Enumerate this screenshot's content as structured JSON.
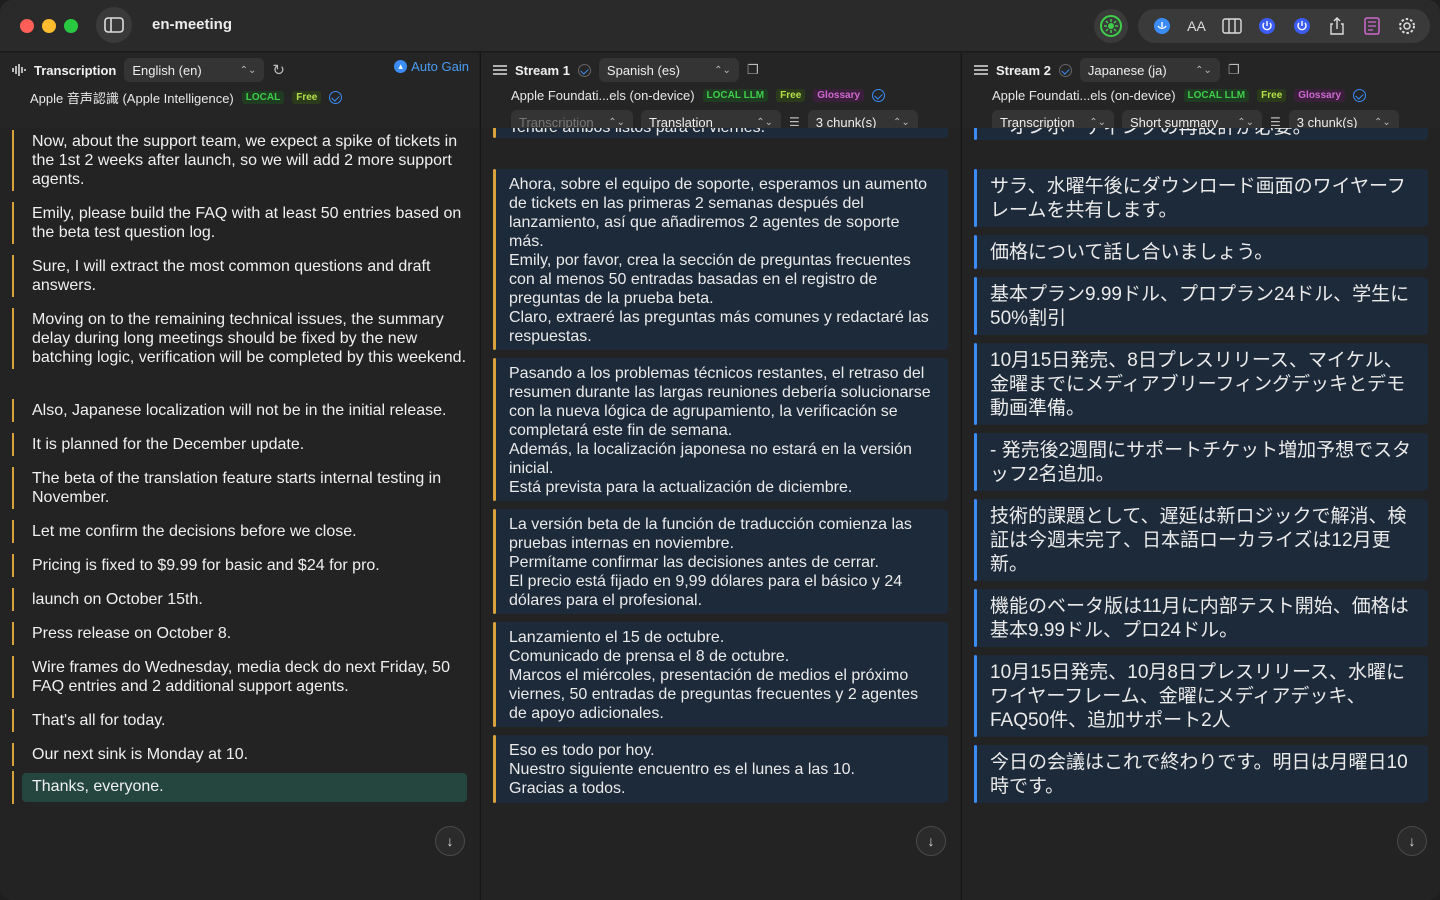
{
  "window": {
    "title": "en-meeting"
  },
  "col1": {
    "title": "Transcription",
    "language": "English (en)",
    "auto_gain": "Auto Gain",
    "model": "Apple 音声認識 (Apple Intelligence)",
    "tag_local": "LOCAL",
    "tag_free": "Free",
    "segments": [
      "Now, about the support team, we expect a spike of tickets in the 1st 2 weeks after launch, so we will add 2 more support agents.",
      "Emily, please build the FAQ with at least 50 entries based on the beta test question log.",
      "Sure, I will extract the most common questions and draft answers.",
      "Moving on to the remaining technical issues, the summary delay during long meetings should be fixed by the new batching logic, verification will be completed by this weekend.",
      "Also, Japanese localization will not be in the initial release.",
      "It is planned for the December update.",
      "The beta of the translation feature starts internal testing in November.",
      "Let me confirm the decisions before we close.",
      "Pricing is fixed to $9.99 for basic and $24 for pro.",
      "launch on October 15th.",
      "Press release on October 8.",
      "Wire frames do Wednesday, media deck do next Friday, 50 FAQ entries and 2 additional support agents.",
      "That's all for today.",
      "Our next sink is Monday at 10.",
      "Thanks, everyone."
    ]
  },
  "col2": {
    "title": "Stream 1",
    "language": "Spanish (es)",
    "model": "Apple Foundati...els (on-device)",
    "tag_local": "LOCAL LLM",
    "tag_free": "Free",
    "tag_glossary": "Glossary",
    "source": "Transcription",
    "mode": "Translation",
    "chunks": "3 chunk(s)",
    "top_partial": "Tendré ambos listos para el viernes.",
    "cards": [
      "Ahora, sobre el equipo de soporte, esperamos un aumento de tickets en las primeras 2 semanas después del lanzamiento, así que añadiremos 2 agentes de soporte más.\nEmily, por favor, crea la sección de preguntas frecuentes con al menos 50 entradas basadas en el registro de preguntas de la prueba beta.\nClaro, extraeré las preguntas más comunes y redactaré las respuestas.",
      "Pasando a los problemas técnicos restantes, el retraso del resumen durante las largas reuniones debería solucionarse con la nueva lógica de agrupamiento, la verificación se completará este fin de semana.\nAdemás, la localización japonesa no estará en la versión inicial.\nEstá prevista para la actualización de diciembre.",
      "La versión beta de la función de traducción comienza las pruebas internas en noviembre.\nPermítame confirmar las decisiones antes de cerrar.\nEl precio está fijado en 9,99 dólares para el básico y 24 dólares para el profesional.",
      "Lanzamiento el 15 de octubre.\nComunicado de prensa el 8 de octubre.\nMarcos el miércoles, presentación de medios el próximo viernes, 50 entradas de preguntas frecuentes y 2 agentes de apoyo adicionales.",
      "Eso es todo por hoy.\nNuestro siguiente encuentro es el lunes a las 10.\nGracias a todos."
    ]
  },
  "col3": {
    "title": "Stream 2",
    "language": "Japanese (ja)",
    "model": "Apple Foundati...els (on-device)",
    "tag_local": "LOCAL LLM",
    "tag_free": "Free",
    "tag_glossary": "Glossary",
    "source": "Transcription",
    "mode": "Short summary",
    "chunks": "3 chunk(s)",
    "top_partial": "・オンボーディングの再設計が必要。",
    "cards": [
      "サラ、水曜午後にダウンロード画面のワイヤーフレームを共有します。",
      "価格について話し合いましょう。",
      "基本プラン9.99ドル、プロプラン24ドル、学生に50%割引",
      "10月15日発売、8日プレスリリース、マイケル、金曜までにメディアブリーフィングデッキとデモ動画準備。",
      "- 発売後2週間にサポートチケット増加予想でスタッフ2名追加。",
      "技術的課題として、遅延は新ロジックで解消、検証は今週末完了、日本語ローカライズは12月更新。",
      "機能のベータ版は11月に内部テスト開始、価格は基本9.99ドル、プロ24ドル。",
      "10月15日発売、10月8日プレスリリース、水曜にワイヤーフレーム、金曜にメディアデッキ、FAQ50件、追加サポート2人",
      "今日の会議はこれで終わりです。明日は月曜日10時です。"
    ]
  },
  "toolbar": {
    "icons": [
      "record-icon",
      "translate-icon",
      "text-size-icon",
      "columns-icon",
      "power-icon",
      "power-alt-icon",
      "share-icon",
      "notes-icon",
      "settings-icon"
    ],
    "text_size_label": "AA"
  }
}
